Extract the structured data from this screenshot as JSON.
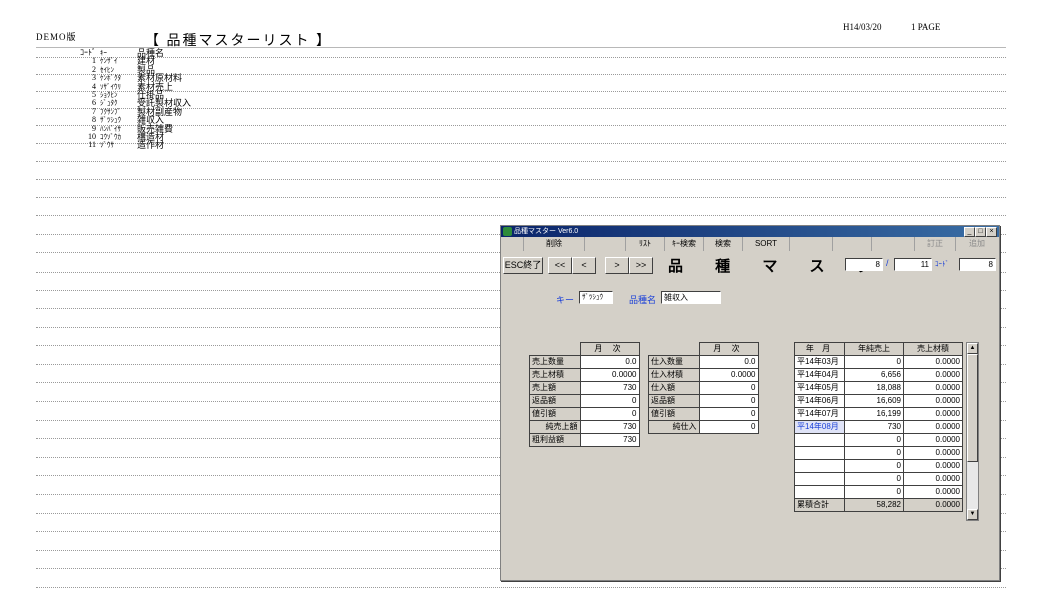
{
  "report": {
    "demo": "DEMO版",
    "title": "【 品種マスターリスト 】",
    "date": "H14/03/20",
    "page": "1 PAGE",
    "header": {
      "code": "ｺｰﾄﾞ",
      "key": "ｷｰ",
      "name": "品種名"
    },
    "rows": [
      {
        "code": "1",
        "key": "ｹﾝｻﾞｲ",
        "name": "建材"
      },
      {
        "code": "2",
        "key": "ｾｲﾋﾝ",
        "name": "製品"
      },
      {
        "code": "3",
        "key": "ｹﾝﾎﾞｸﾀ",
        "name": "素材原材料"
      },
      {
        "code": "4",
        "key": "ｿｻﾞｲｳﾘ",
        "name": "素材売上"
      },
      {
        "code": "5",
        "key": "ｼｮｸﾋﾝ",
        "name": "仕掛品"
      },
      {
        "code": "6",
        "key": "ｼﾞｭﾀｸ",
        "name": "受託製材収入"
      },
      {
        "code": "7",
        "key": "ﾌｸｻﾝﾌﾞ",
        "name": "製材副産物"
      },
      {
        "code": "8",
        "key": "ｻﾞﾂｼｭｳ",
        "name": "雑収入"
      },
      {
        "code": "9",
        "key": "ﾊﾝﾊﾞｲｻ",
        "name": "販売雑費"
      },
      {
        "code": "10",
        "key": "ｺｳｿﾞｳｶ",
        "name": "構造材"
      },
      {
        "code": "11",
        "key": "ｿﾞｳｻ",
        "name": "造作材"
      }
    ]
  },
  "window": {
    "title": "品種マスター Ver6.0",
    "controls": {
      "minimize": "_",
      "maximize": "□",
      "close": "×"
    },
    "menu": {
      "delete": "削除",
      "list": "ﾘｽﾄ",
      "key_search": "ｷｰ検索",
      "search": "検索",
      "sort": "SORT",
      "edit": "訂正",
      "add": "追加"
    },
    "buttons": {
      "esc": "ESC終了",
      "first": "<<",
      "prev": "<",
      "next": ">",
      "last": ">>"
    },
    "heading": "品 種 マ ス タ ー",
    "record": {
      "current": "8",
      "sep": "/",
      "total": "11",
      "code_label": "ｺｰﾄﾞ",
      "code": "8"
    },
    "key_label": "キー",
    "key_value": "ｻﾞﾂｼｭｳ",
    "name_label": "品種名",
    "name_value": "雑収入",
    "sales": {
      "header": "月 次",
      "rows": [
        {
          "label": "売上数量",
          "value": "0.0"
        },
        {
          "label": "売上材積",
          "value": "0.0000"
        },
        {
          "label": "売上額",
          "value": "730"
        },
        {
          "label": "返品額",
          "value": "0"
        },
        {
          "label": "値引額",
          "value": "0"
        },
        {
          "label": "純売上額",
          "value": "730"
        },
        {
          "label": "粗利益額",
          "value": "730"
        }
      ]
    },
    "purchase": {
      "header": "月 次",
      "rows": [
        {
          "label": "仕入数量",
          "value": "0.0"
        },
        {
          "label": "仕入材積",
          "value": "0.0000"
        },
        {
          "label": "仕入額",
          "value": "0"
        },
        {
          "label": "返品額",
          "value": "0"
        },
        {
          "label": "値引額",
          "value": "0"
        },
        {
          "label": "純仕入",
          "value": "0"
        }
      ]
    },
    "monthly": {
      "headers": [
        "年 月",
        "年純売上",
        "売上材積"
      ],
      "rows": [
        {
          "month": "平14年03月",
          "sales": "0",
          "volume": "0.0000"
        },
        {
          "month": "平14年04月",
          "sales": "6,656",
          "volume": "0.0000"
        },
        {
          "month": "平14年05月",
          "sales": "18,088",
          "volume": "0.0000"
        },
        {
          "month": "平14年06月",
          "sales": "16,609",
          "volume": "0.0000"
        },
        {
          "month": "平14年07月",
          "sales": "16,199",
          "volume": "0.0000"
        },
        {
          "month": "平14年08月",
          "sales": "730",
          "volume": "0.0000"
        },
        {
          "month": "",
          "sales": "0",
          "volume": "0.0000"
        },
        {
          "month": "",
          "sales": "0",
          "volume": "0.0000"
        },
        {
          "month": "",
          "sales": "0",
          "volume": "0.0000"
        },
        {
          "month": "",
          "sales": "0",
          "volume": "0.0000"
        },
        {
          "month": "",
          "sales": "0",
          "volume": "0.0000"
        }
      ],
      "total_label": "累積合計",
      "total_sales": "58,282",
      "total_volume": "0.0000",
      "scroll_up": "▲",
      "scroll_down": "▼"
    }
  }
}
